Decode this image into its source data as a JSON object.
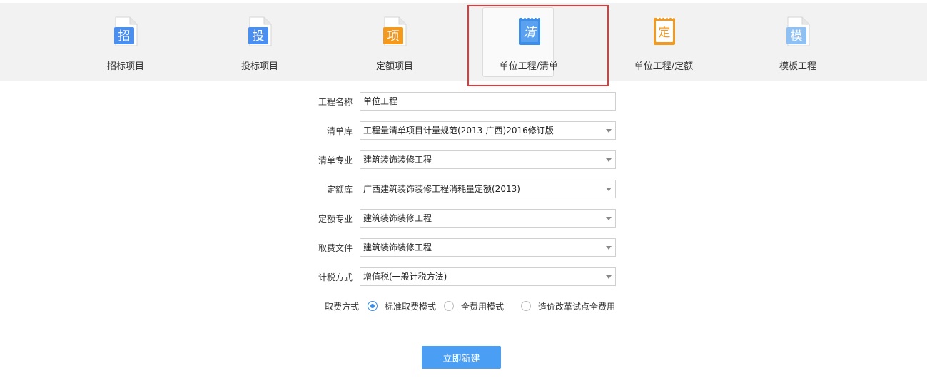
{
  "tabs": [
    {
      "icon_char": "招",
      "label": "招标项目",
      "color": "#4a8ff0"
    },
    {
      "icon_char": "投",
      "label": "投标项目",
      "color": "#4a8ff0"
    },
    {
      "icon_char": "项",
      "label": "定额项目",
      "color": "#f39a1e"
    },
    {
      "icon_char": "清",
      "label": "单位工程/清单",
      "color": "#3d8ee8"
    },
    {
      "icon_char": "定",
      "label": "单位工程/定额",
      "color": "#f39a1e"
    },
    {
      "icon_char": "模",
      "label": "模板工程",
      "color": "#8ec0f4"
    }
  ],
  "selected_tab": "单位工程/清单",
  "form": {
    "project_name": {
      "label": "工程名称",
      "value": "单位工程"
    },
    "bill_library": {
      "label": "清单库",
      "value": "工程量清单项目计量规范(2013-广西)2016修订版"
    },
    "bill_specialty": {
      "label": "清单专业",
      "value": "建筑装饰装修工程"
    },
    "quota_library": {
      "label": "定额库",
      "value": "广西建筑装饰装修工程消耗量定额(2013)"
    },
    "quota_specialty": {
      "label": "定额专业",
      "value": "建筑装饰装修工程"
    },
    "fee_file": {
      "label": "取费文件",
      "value": "建筑装饰装修工程"
    },
    "tax_method": {
      "label": "计税方式",
      "value": "增值税(一般计税方法)"
    },
    "fee_mode": {
      "label": "取费方式",
      "options": [
        "标准取费模式",
        "全费用模式",
        "造价改革试点全费用"
      ],
      "selected": "标准取费模式"
    }
  },
  "submit_label": "立即新建",
  "colors": {
    "accent": "#4a9ff5",
    "highlight": "#e03a3a",
    "topbar": "#f2f2f2"
  }
}
